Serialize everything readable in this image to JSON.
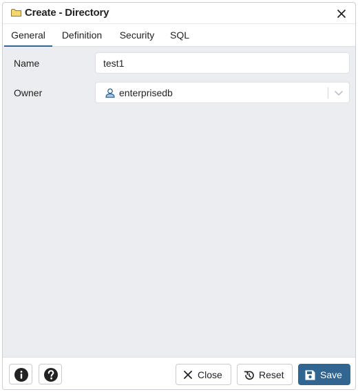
{
  "window": {
    "title": "Create - Directory",
    "title_icon": "folder-icon",
    "close_icon": "close-icon"
  },
  "tabs": [
    {
      "label": "General",
      "active": true
    },
    {
      "label": "Definition",
      "active": false
    },
    {
      "label": "Security",
      "active": false
    },
    {
      "label": "SQL",
      "active": false
    }
  ],
  "form": {
    "name": {
      "label": "Name",
      "value": "test1"
    },
    "owner": {
      "label": "Owner",
      "value": "enterprisedb",
      "icon": "user-icon"
    }
  },
  "footer": {
    "info_icon": "info-icon",
    "help_icon": "help-icon",
    "close_label": "Close",
    "reset_label": "Reset",
    "save_label": "Save"
  },
  "colors": {
    "accent": "#326690",
    "folder": "#f5d76e",
    "body_bg": "#ebedf0"
  }
}
